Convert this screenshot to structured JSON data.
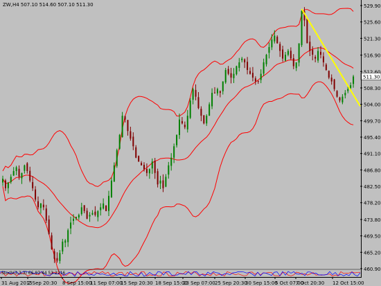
{
  "chart_info": "ZW,H4  507.10 514.60 507.10 511.30",
  "indicator_info": "Stoch(3,3,3) 66.97 44 53.2716",
  "current_price_label": "511.30",
  "colors": {
    "background": "#c0c0c0",
    "bullish": "#008000",
    "bearish": "#800000",
    "bands": "#ff0000",
    "trendline": "#ffff00",
    "price_tag_bg": "#ffffff"
  },
  "chart_data": {
    "type": "candlestick",
    "symbol": "ZW",
    "timeframe": "H4",
    "ohlc": {
      "open": 507.1,
      "high": 514.6,
      "low": 507.1,
      "close": 511.3
    },
    "y_ticks": [
      "529.90",
      "525.60",
      "521.30",
      "516.90",
      "512.60",
      "508.30",
      "504.00",
      "499.70",
      "495.40",
      "491.10",
      "486.80",
      "482.50",
      "478.20",
      "473.80",
      "469.50",
      "465.20",
      "460.90"
    ],
    "x_ticks": [
      "31 Aug 2015",
      "2 Sep 20:30",
      "8 Sep 15:00",
      "11 Sep 07:00",
      "15 Sep 20:30",
      "18 Sep 15:00",
      "23 Sep 07:00",
      "25 Sep 20:30",
      "30 Sep 15:00",
      "5 Oct 07:00",
      "7 Oct 20:30",
      "12 Oct 15:00"
    ],
    "ylim": [
      460.9,
      529.9
    ],
    "closes": [
      484.5,
      482,
      483.5,
      485,
      486.5,
      487.5,
      485,
      486,
      488,
      486.5,
      484,
      482,
      479,
      477,
      478,
      477,
      473.5,
      470,
      466,
      463.5,
      463,
      465,
      468,
      468.3,
      471,
      473,
      474,
      474.5,
      475,
      477,
      476,
      474,
      475,
      475.5,
      475,
      476,
      477,
      478,
      476,
      480,
      484,
      488,
      492,
      496,
      501,
      500,
      497,
      495,
      493,
      490,
      489,
      488,
      487,
      486,
      487,
      489,
      486,
      483,
      484,
      482,
      485,
      488,
      490,
      493,
      496,
      500,
      499,
      498,
      501,
      505,
      508,
      506,
      503,
      501,
      499,
      501,
      504,
      507,
      507,
      508,
      507,
      510,
      513,
      512,
      511,
      512,
      514,
      515,
      516,
      515,
      513,
      512,
      511,
      510,
      510,
      512,
      515,
      517,
      519,
      521,
      522,
      520,
      518,
      516,
      517,
      518,
      516,
      514,
      515,
      520,
      528.5,
      526,
      520,
      518,
      517,
      516,
      518,
      517,
      515,
      513,
      511,
      510,
      508,
      506,
      505,
      506,
      507,
      508,
      509,
      511.3
    ]
  },
  "indicator_data": {
    "name": "Stoch",
    "params": "3,3,3",
    "values": [
      66.97,
      44,
      53.2716
    ]
  }
}
